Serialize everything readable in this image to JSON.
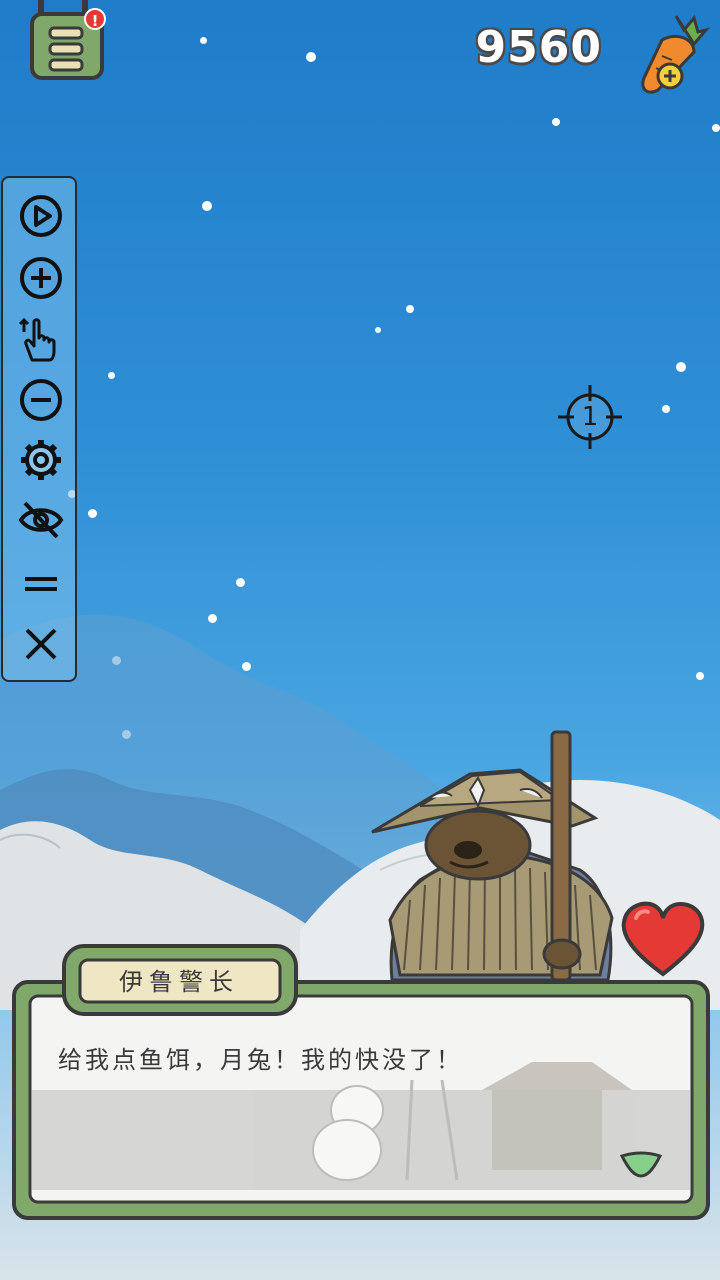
{
  "hud": {
    "carrot_count": "9560",
    "backpack_icon": "backpack-icon",
    "alert_badge": "!",
    "carrot_icon": "carrot-plus-icon"
  },
  "tool_panel": {
    "items": [
      {
        "name": "play-icon"
      },
      {
        "name": "zoom-in-icon"
      },
      {
        "name": "tap-gesture-icon"
      },
      {
        "name": "zoom-out-icon"
      },
      {
        "name": "gear-icon"
      },
      {
        "name": "eye-off-icon"
      },
      {
        "name": "drag-handle-icon"
      },
      {
        "name": "close-icon"
      }
    ]
  },
  "crosshair": {
    "number": "1",
    "icon": "crosshair-icon"
  },
  "dialog": {
    "speaker": "伊鲁警长",
    "text": "给我点鱼饵，月兔！我的快没了！"
  },
  "colors": {
    "sky_top": "#1f7cc9",
    "dialog_frame": "#7fa86a",
    "heart": "#e53935"
  }
}
